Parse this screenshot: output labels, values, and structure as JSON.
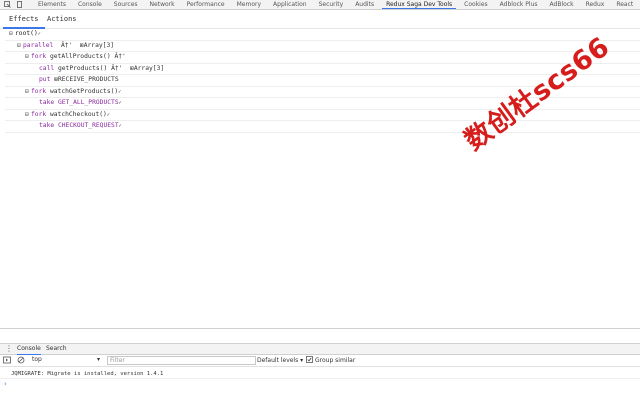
{
  "devtools": {
    "tabs": [
      {
        "label": "Elements"
      },
      {
        "label": "Console"
      },
      {
        "label": "Sources"
      },
      {
        "label": "Network"
      },
      {
        "label": "Performance"
      },
      {
        "label": "Memory"
      },
      {
        "label": "Application"
      },
      {
        "label": "Security"
      },
      {
        "label": "Audits"
      },
      {
        "label": "Redux Saga Dev Tools"
      },
      {
        "label": "Cookies"
      },
      {
        "label": "Adblock Plus"
      },
      {
        "label": "AdBlock"
      },
      {
        "label": "Redux"
      },
      {
        "label": "React"
      }
    ],
    "active_tab": "Redux Saga Dev Tools"
  },
  "saga_panel": {
    "subtabs": [
      {
        "label": "Effects"
      },
      {
        "label": "Actions"
      }
    ],
    "active_subtab": "Effects",
    "effects": {
      "root": {
        "label": "root()",
        "check": "✓"
      },
      "parallel": {
        "keyword": "parallel",
        "mark": "Â†'",
        "value": "Array[3]"
      },
      "fork1": {
        "keyword": "fork",
        "name": "getAllProducts()",
        "mark": "Â†'"
      },
      "call": {
        "keyword": "call",
        "name": "getProducts()",
        "mark": "Â†'",
        "value": "Array[3]"
      },
      "put": {
        "keyword": "put",
        "name": "RECEIVE_PRODUCTS"
      },
      "fork2": {
        "keyword": "fork",
        "name": "watchGetProducts()",
        "check": "✓"
      },
      "take1": {
        "keyword": "take",
        "name": "GET_ALL_PRODUCTS",
        "check": "✓"
      },
      "fork3": {
        "keyword": "fork",
        "name": "watchCheckout()",
        "check": "✓"
      },
      "take2": {
        "keyword": "take",
        "name": "CHECKOUT_REQUEST",
        "check": "✓"
      }
    }
  },
  "watermark": "数创杜scs66",
  "console": {
    "tabs": [
      {
        "label": "Console"
      },
      {
        "label": "Search"
      }
    ],
    "context": "top",
    "filter_placeholder": "Filter",
    "levels": "Default levels ▾",
    "group_similar": "Group similar",
    "group_similar_checked": true,
    "message": "JQMIGRATE: Migrate is installed, version 1.4.1",
    "prompt": "›"
  },
  "colors": {
    "keyword": "#8b2b9f",
    "accent": "#3b78e7",
    "watermark": "#d71c1c"
  }
}
